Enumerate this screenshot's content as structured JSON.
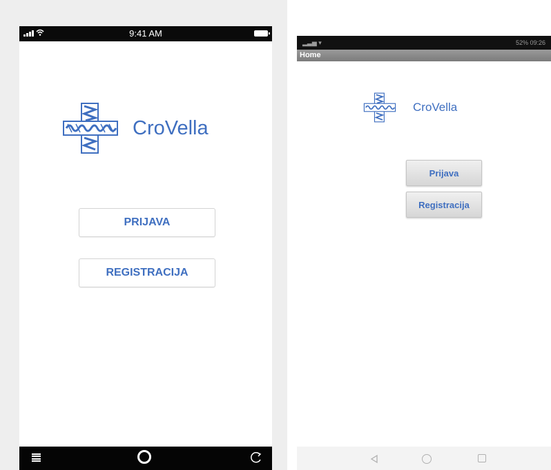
{
  "left_phone": {
    "status_time": "9:41 AM",
    "brand_name": "CroVella",
    "login_button": "PRIJAVA",
    "register_button": "REGISTRACIJA",
    "icons": [
      "signal-icon",
      "wifi-icon",
      "battery-icon",
      "menu-icon",
      "home-icon",
      "refresh-icon"
    ]
  },
  "right_phone": {
    "status_right": "52% 09:26",
    "title": "Home",
    "brand_name": "CroVella",
    "login_button": "Prijava",
    "register_button": "Registracija",
    "icons": [
      "back-icon",
      "home-icon",
      "recents-icon"
    ]
  },
  "colors": {
    "brand_blue": "#3f6fc0",
    "status_bar": "#0a0a0a",
    "android_titlebar": "#8a8a8a"
  }
}
